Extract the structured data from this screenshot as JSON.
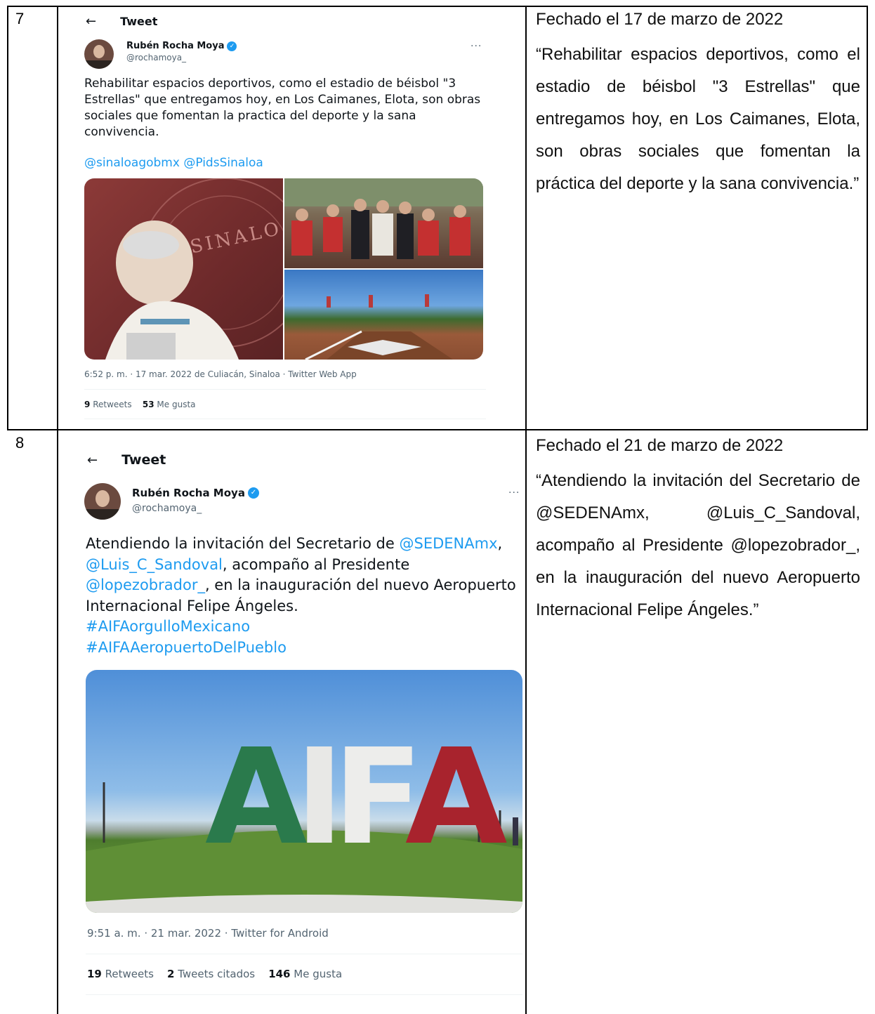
{
  "rows": [
    {
      "number": "7",
      "tweet": {
        "header_title": "Tweet",
        "back_icon": "←",
        "author_name": "Rubén Rocha Moya",
        "author_handle": "@rochamoya_",
        "more_icon": "···",
        "text": "Rehabilitar espacios deportivos, como el estadio de béisbol \"3 Estrellas\" que entregamos hoy, en Los Caimanes, Elota, son obras sociales que fomentan la practica del deporte y la sana convivencia.",
        "mentions": "@sinaloagobmx @PidsSinaloa",
        "image_text": "SINALO",
        "timestamp": "6:52 p. m. · 17 mar. 2022 de Culiacán, Sinaloa · Twitter Web App",
        "retweets_count": "9",
        "retweets_label": "Retweets",
        "likes_count": "53",
        "likes_label": "Me gusta"
      },
      "date_text": "Fechado el 17 de marzo de 2022",
      "quote": "“Rehabilitar espacios deportivos, como el estadio de béisbol \"3 Estrellas\" que entregamos hoy, en Los Caimanes, Elota, son obras sociales que fomentan la práctica del deporte y la sana convivencia.”"
    },
    {
      "number": "8",
      "tweet": {
        "header_title": "Tweet",
        "back_icon": "←",
        "author_name": "Rubén Rocha Moya",
        "author_handle": "@rochamoya_",
        "more_icon": "···",
        "text_1": "Atendiendo la invitación del Secretario de",
        "link_1": "@SEDENAmx",
        "sep_1": ", ",
        "link_2": "@Luis_C_Sandoval",
        "text_2": ", acompaño al Presidente ",
        "link_3": "@lopezobrador_",
        "text_3": ", en la inauguración del nuevo Aeropuerto Internacional Felipe Ángeles.",
        "hashtag_1": "#AIFAorgulloMexicano",
        "hashtag_2": "#AIFAAeropuertoDelPueblo",
        "image_letters": [
          "A",
          "I",
          "F",
          "A"
        ],
        "timestamp": "9:51 a. m. · 21 mar. 2022 · Twitter for Android",
        "retweets_count": "19",
        "retweets_label": "Retweets",
        "quotes_count": "2",
        "quotes_label": "Tweets citados",
        "likes_count": "146",
        "likes_label": "Me gusta"
      },
      "date_text": "Fechado el 21 de marzo de 2022",
      "quote": "“Atendiendo la invitación del Secretario de @SEDENAmx, @Luis_C_Sandoval, acompaño al Presidente @lopezobrador_, en la inauguración del nuevo Aeropuerto Internacional Felipe Ángeles.”"
    }
  ],
  "colors": {
    "link": "#1d9bf0",
    "secondary_text": "#536471",
    "text": "#0f1419"
  }
}
